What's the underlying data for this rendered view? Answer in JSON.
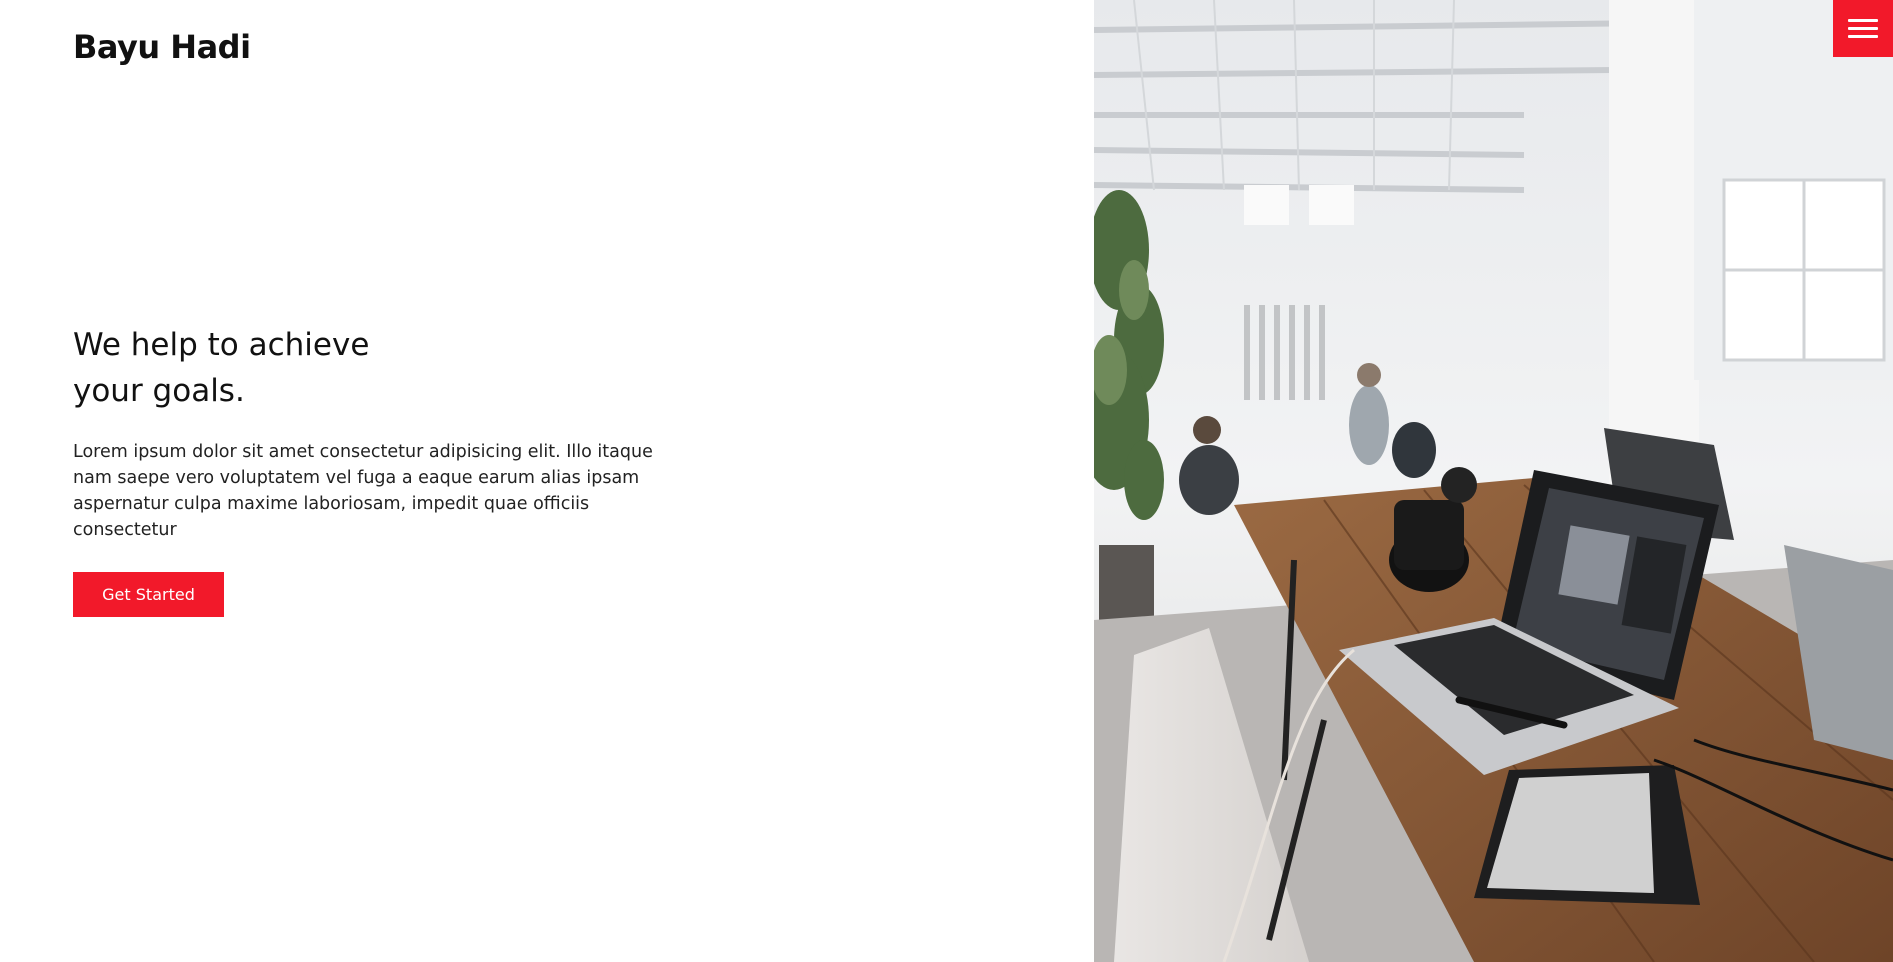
{
  "brand": {
    "name": "Bayu Hadi"
  },
  "hero": {
    "title_line1": "We help to achieve",
    "title_line2": "your goals.",
    "description": "Lorem ipsum dolor sit amet consectetur adipisicing elit. Illo itaque nam saepe vero voluptatem vel fuga a eaque earum alias ipsam aspernatur culpa maxime laboriosam, impedit quae officiis consectetur",
    "cta_label": "Get Started"
  },
  "menu": {
    "icon": "hamburger-menu-icon"
  },
  "colors": {
    "accent": "#f2192a",
    "text": "#111111",
    "background": "#ffffff"
  }
}
